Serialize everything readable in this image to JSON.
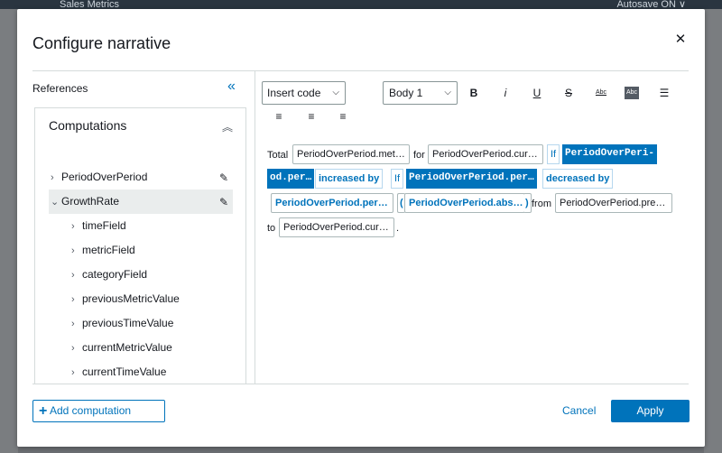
{
  "background": {
    "app_title": "Sales Metrics",
    "autosave": "Autosave ON ∨"
  },
  "modal": {
    "title": "Configure narrative",
    "close_icon": "close-icon"
  },
  "references": {
    "label": "References",
    "collapse_icon": "double-chevron-left-icon",
    "computations_label": "Computations",
    "computations_toggle_icon": "double-chevron-up-icon",
    "items": [
      {
        "label": "PeriodOverPeriod",
        "expanded": false,
        "selected": false
      },
      {
        "label": "GrowthRate",
        "expanded": true,
        "selected": true
      }
    ],
    "children": [
      "timeField",
      "metricField",
      "categoryField",
      "previousMetricValue",
      "previousTimeValue",
      "currentMetricValue",
      "currentTimeValue"
    ]
  },
  "toolbar": {
    "insert_code": "Insert code",
    "style": "Body 1",
    "bold": "B",
    "italic": "i",
    "underline": "U",
    "strikethrough": "S",
    "text_color": "Abc",
    "highlight": "Abc",
    "list_icon": "bulleted-list-icon",
    "align_left_icon": "align-left-icon",
    "align_center_icon": "align-center-icon",
    "align_right_icon": "align-right-icon"
  },
  "narrative": {
    "t_total": "Total",
    "r1": "PeriodOverPeriod.met…",
    "t_for": "for",
    "r2": "PeriodOverPeriod.cur…",
    "k_if1": "If",
    "h1a": "PeriodOverPeri-",
    "h1b": "od.per…",
    "k_increased": "increased by",
    "k_if2": "If",
    "h2": "PeriodOverPeriod.per…",
    "k_decreased": "decreased by",
    "b1": "PeriodOverPeriod.per…",
    "p_open": "(",
    "b2": "PeriodOverPeriod.abs…",
    "p_close": ")",
    "t_from": "from",
    "r3": "PeriodOverPeriod.pre…",
    "t_to": "to",
    "r4": "PeriodOverPeriod.cur…",
    "t_dot": "."
  },
  "footer": {
    "add_computation": "Add computation",
    "cancel": "Cancel",
    "apply": "Apply"
  }
}
